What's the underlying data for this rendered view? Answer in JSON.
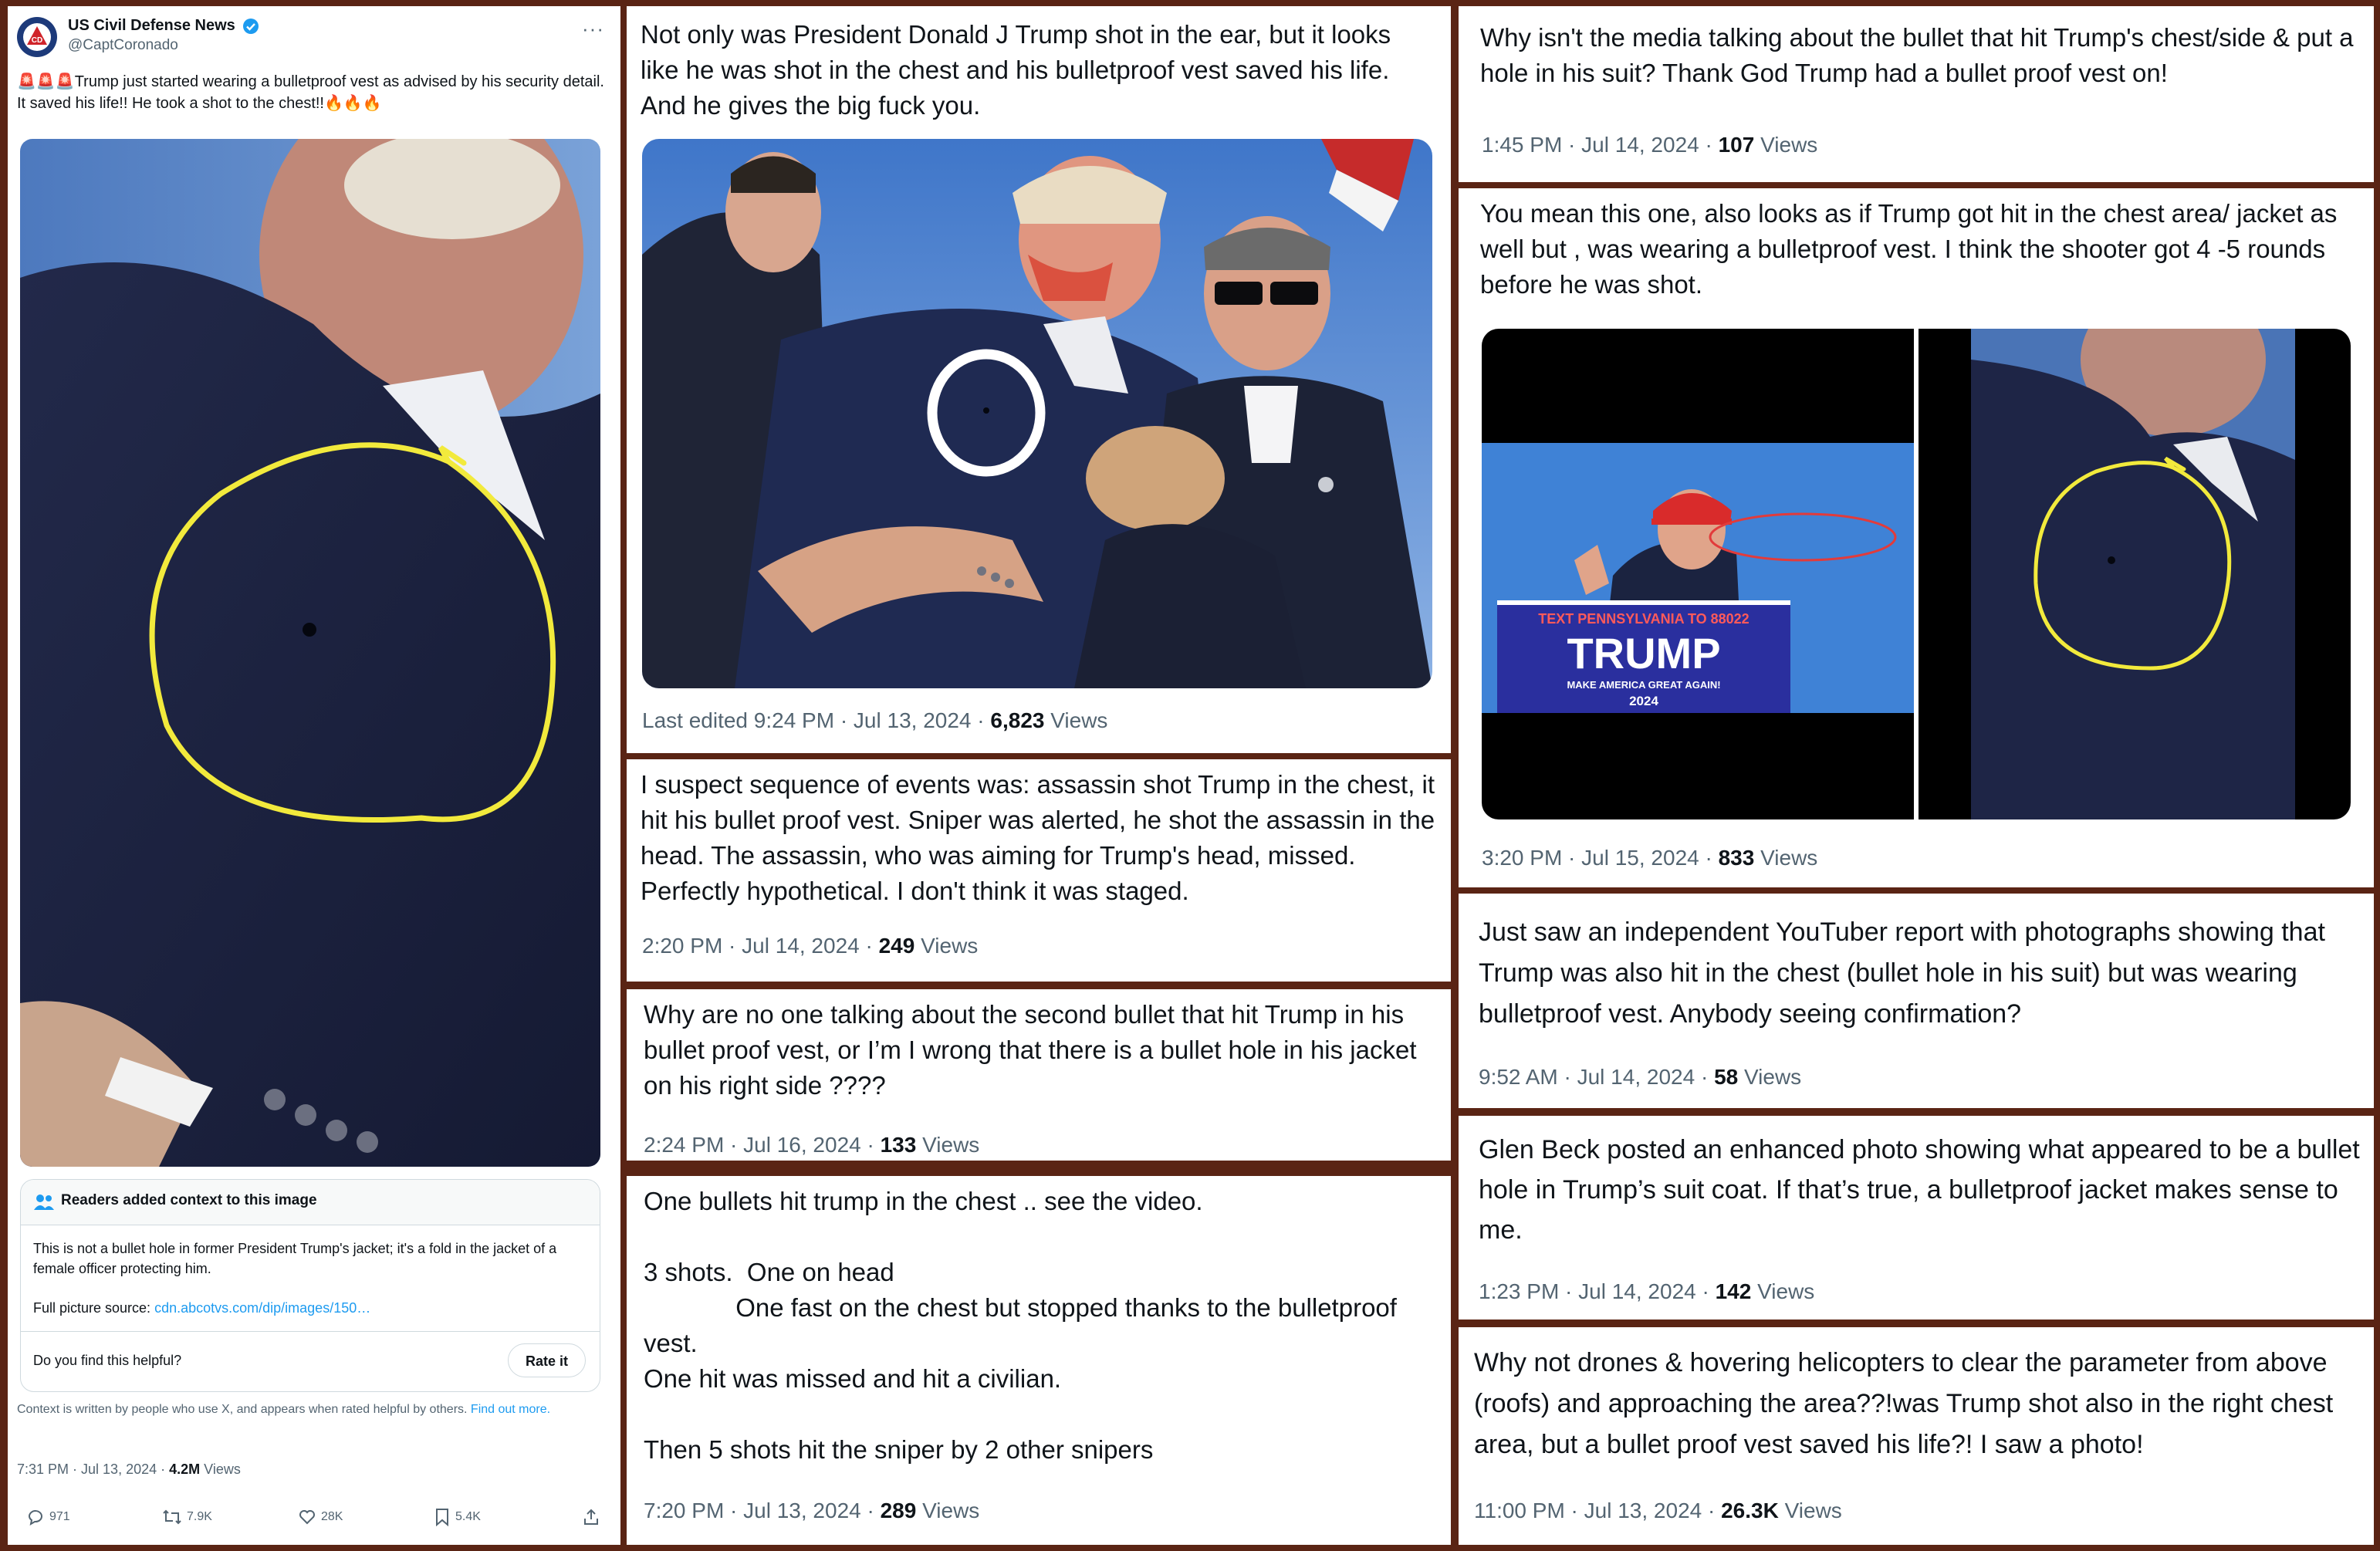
{
  "main_post": {
    "account_name": "US Civil Defense News",
    "handle": "@CaptCoronado",
    "text": "🚨🚨🚨Trump just started wearing a bulletproof vest as advised by his security detail. It saved his life!! He took a shot to the chest!!🔥🔥🔥",
    "community_note": {
      "header": "Readers added context to this image",
      "body": "This is not a bullet hole in former President Trump's jacket; it's a fold in the jacket of a female officer protecting him.",
      "source_label": "Full picture source:",
      "source_link": "cdn.abcotvs.com/dip/images/150…",
      "helpful_question": "Do you find this helpful?",
      "rate_button": "Rate it",
      "footer": "Context is written by people who use X, and appears when rated helpful by others.",
      "footer_link": "Find out more."
    },
    "time": "7:31 PM · Jul 13, 2024 · ",
    "views_count": "4.2M",
    "views_label": " Views",
    "replies": "971",
    "reposts": "7.9K",
    "likes": "28K",
    "bookmarks": "5.4K"
  },
  "middle_posts": [
    {
      "text": "Not only was President Donald J Trump shot in the ear, but it looks like he was shot in the chest and his bulletproof vest saved his life. And he gives the big fuck you.",
      "time": "Last edited 9:24 PM · Jul 13, 2024 · ",
      "views_count": "6,823",
      "views_label": " Views"
    },
    {
      "text": "I suspect sequence of events was: assassin shot Trump in the chest, it hit his bullet proof vest. Sniper was alerted, he shot the assassin in the head. The assassin, who was aiming for Trump's head, missed. Perfectly hypothetical. I don't think it was staged.",
      "time": "2:20 PM · Jul 14, 2024 · ",
      "views_count": "249",
      "views_label": " Views"
    },
    {
      "text": "Why are no one talking about the second bullet that hit Trump in his bullet proof vest, or I’m I wrong that there is a bullet hole in his jacket on his right side ????",
      "time": "2:24 PM · Jul 16, 2024 · ",
      "views_count": "133",
      "views_label": " Views"
    },
    {
      "text": "One bullets hit trump in the chest .. see the video.\n\n3 shots.  One on head\n             One fast on the chest but stopped thanks to the bulletproof vest.\nOne hit was missed and hit a civilian.\n\nThen 5 shots hit the sniper by 2 other snipers",
      "time": "7:20 PM · Jul 13, 2024 · ",
      "views_count": "289",
      "views_label": " Views"
    }
  ],
  "right_posts": [
    {
      "text": "Why isn't the media talking about the bullet that hit Trump's chest/side & put a hole in his suit? Thank God Trump had a bullet proof vest on!",
      "time": "1:45 PM · Jul 14, 2024 · ",
      "views_count": "107",
      "views_label": " Views"
    },
    {
      "text": "You mean this one, also looks as if Trump got hit in the chest area/ jacket as well but , was wearing a bulletproof vest. I think the shooter got 4 -5 rounds before he was shot.",
      "time": "3:20 PM · Jul 15, 2024 · ",
      "views_count": "833",
      "views_label": " Views",
      "podium": {
        "banner": "TEXT PENNSYLVANIA TO 88022",
        "name": "TRUMP",
        "slogan": "MAKE AMERICA GREAT AGAIN!",
        "year": "2024"
      }
    },
    {
      "text": "Just saw an independent YouTuber report with photographs showing that  Trump was also hit in the chest (bullet hole in his suit) but was wearing bulletproof vest. Anybody seeing confirmation?",
      "time": "9:52 AM · Jul 14, 2024 · ",
      "views_count": "58",
      "views_label": " Views"
    },
    {
      "text": "Glen Beck posted an enhanced photo showing what appeared to be a bullet hole in Trump’s suit coat. If that’s true, a bulletproof jacket makes sense to me.",
      "time": "1:23 PM · Jul 14, 2024 · ",
      "views_count": "142",
      "views_label": " Views"
    },
    {
      "text": "Why not drones & hovering helicopters to clear the parameter from above (roofs) and approaching the area??!was Trump shot also in the right chest area, but a bullet proof vest saved his life?! I saw a photo!",
      "time": "11:00 PM · Jul 13, 2024 · ",
      "views_count": "26.3K",
      "views_label": " Views"
    }
  ],
  "colors": {
    "border": "#5a2414",
    "annotation": "#f2ea3c",
    "link": "#1d9bf0",
    "verified": "#1d9bf0",
    "muted": "#536471"
  }
}
